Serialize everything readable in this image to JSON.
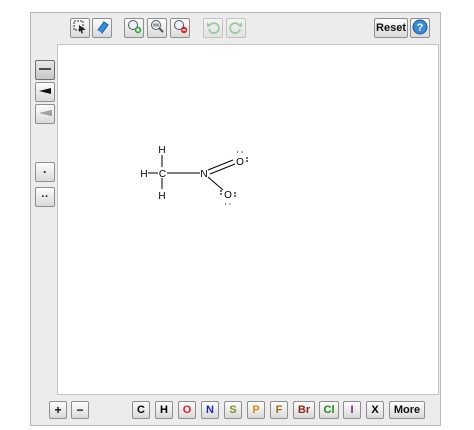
{
  "toolbar": {
    "reset_label": "Reset",
    "help_label": "?"
  },
  "left_tools": {
    "dot_label": "·",
    "pair_label": "··"
  },
  "bottom": {
    "plus_label": "+",
    "minus_label": "−",
    "elements": [
      "C",
      "H",
      "O",
      "N",
      "S",
      "P",
      "F",
      "Br",
      "Cl",
      "I",
      "X"
    ],
    "more_label": "More"
  },
  "element_colors": {
    "C": "#000000",
    "H": "#000000",
    "O": "#e8182b",
    "N": "#1c2bb0",
    "S": "#8a8a1c",
    "P": "#d88a1a",
    "F": "#a46a1e",
    "Br": "#8a2a1a",
    "Cl": "#1f8a1f",
    "I": "#7a1f8a",
    "X": "#000000"
  },
  "molecule": {
    "atoms": [
      "H",
      "H",
      "C",
      "H",
      "N",
      "O",
      "O"
    ],
    "lone_pairs": [
      ":",
      ":"
    ]
  }
}
